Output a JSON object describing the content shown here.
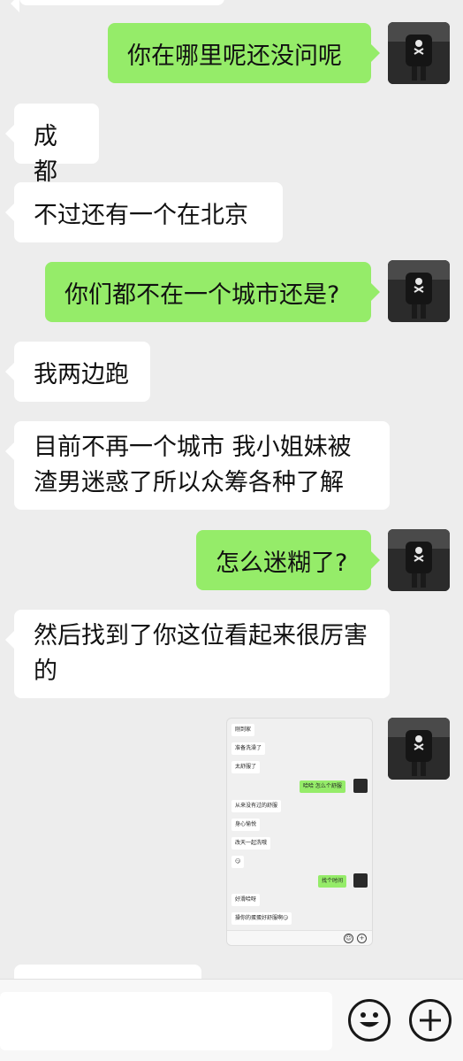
{
  "conversation": {
    "messages": [
      {
        "side": "out",
        "text": "你在哪里呢还没问呢"
      },
      {
        "side": "in",
        "text": "成都"
      },
      {
        "side": "in",
        "text": "不过还有一个在北京"
      },
      {
        "side": "out",
        "text": "你们都不在一个城市还是?"
      },
      {
        "side": "in",
        "text": "我两边跑"
      },
      {
        "side": "in",
        "text": "目前不再一个城市 我小姐妹被渣男迷惑了所以众筹各种了解"
      },
      {
        "side": "out",
        "text": "怎么迷糊了?"
      },
      {
        "side": "in",
        "text": "然后找到了你这位看起来很厉害的"
      }
    ],
    "image_message": {
      "messages": [
        {
          "side": "in",
          "text": "刚到家"
        },
        {
          "side": "in",
          "text": "准备洗澡了"
        },
        {
          "side": "in",
          "text": "太舒服了"
        },
        {
          "side": "out",
          "text": "哈哈 怎么个舒服"
        },
        {
          "side": "in",
          "text": "从来没有过的舒服"
        },
        {
          "side": "in",
          "text": "身心愉悦"
        },
        {
          "side": "in",
          "text": "改天一起洗哦"
        },
        {
          "side": "in",
          "text": "😏"
        },
        {
          "side": "out",
          "text": "找个时间"
        },
        {
          "side": "in",
          "text": "好滑哈呀"
        },
        {
          "side": "in",
          "text": "操你的蛋蛋好舒服啊😏"
        }
      ]
    }
  },
  "input_bar": {
    "emoji_icon": "smiley-face-icon",
    "plus_icon": "plus-circle-icon"
  }
}
